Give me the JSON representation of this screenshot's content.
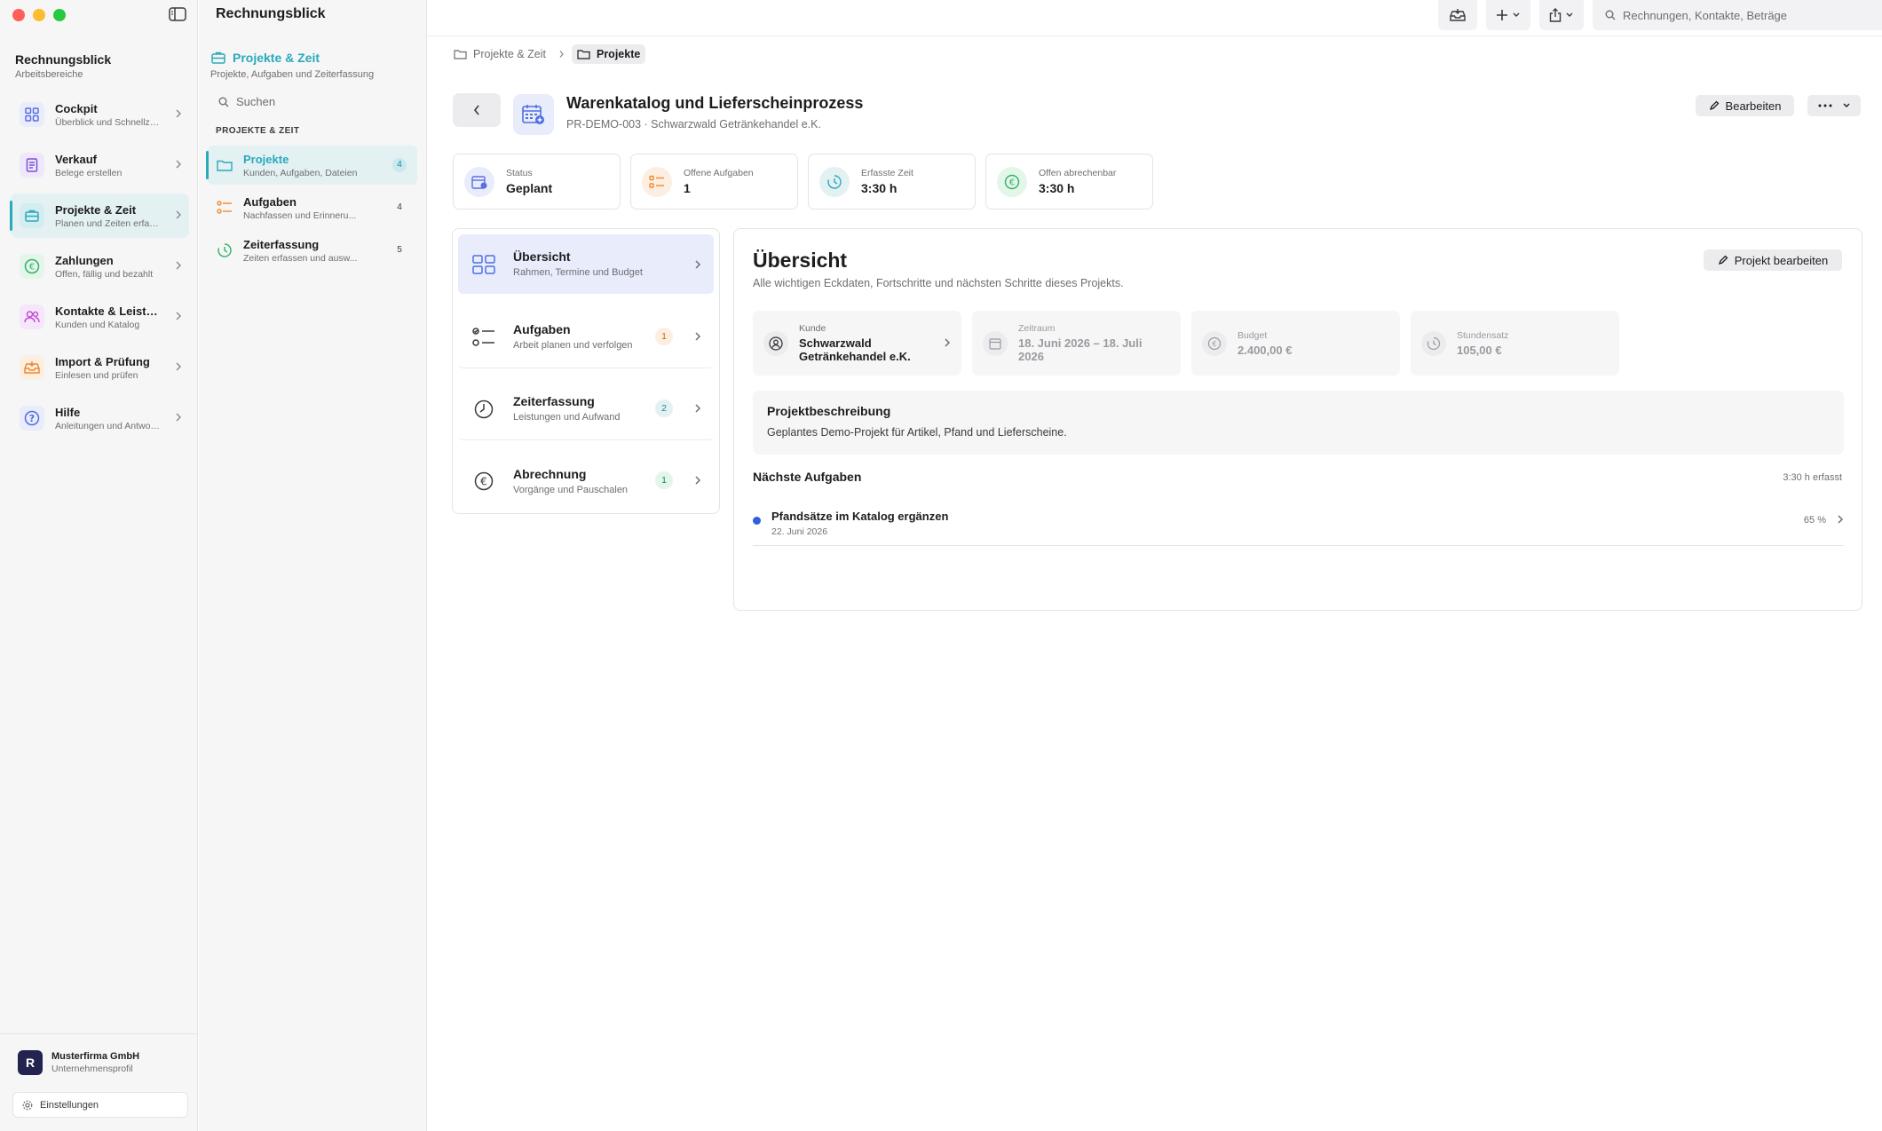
{
  "app": {
    "title": "Rechnungsblick"
  },
  "workspace": {
    "title": "Rechnungsblick",
    "subtitle": "Arbeitsbereiche"
  },
  "sidebar": {
    "items": [
      {
        "label": "Cockpit",
        "sub": "Überblick und Schnellzu...",
        "color": "#5b6ee1"
      },
      {
        "label": "Verkauf",
        "sub": "Belege erstellen",
        "color": "#7b4fd6"
      },
      {
        "label": "Projekte & Zeit",
        "sub": "Planen und Zeiten erfass...",
        "color": "#2aa9bb"
      },
      {
        "label": "Zahlungen",
        "sub": "Offen, fällig und bezahlt",
        "color": "#2fb366"
      },
      {
        "label": "Kontakte & Leistung...",
        "sub": "Kunden und Katalog",
        "color": "#c24fd6"
      },
      {
        "label": "Import & Prüfung",
        "sub": "Einlesen und prüfen",
        "color": "#ef8a2c"
      },
      {
        "label": "Hilfe",
        "sub": "Anleitungen und Antwort...",
        "color": "#4f6ee1"
      }
    ],
    "company": {
      "logo": "R",
      "name": "Musterfirma GmbH",
      "sub": "Unternehmensprofil"
    },
    "settings_label": "Einstellungen"
  },
  "subnav": {
    "title": "Projekte & Zeit",
    "description": "Projekte, Aufgaben und Zeiterfassung",
    "search_placeholder": "Suchen",
    "section": "PROJEKTE & ZEIT",
    "items": [
      {
        "label": "Projekte",
        "sub": "Kunden, Aufgaben, Dateien",
        "count": "4"
      },
      {
        "label": "Aufgaben",
        "sub": "Nachfassen und Erinneru...",
        "count": "4"
      },
      {
        "label": "Zeiterfassung",
        "sub": "Zeiten erfassen und ausw...",
        "count": "5"
      }
    ]
  },
  "toolbar": {
    "search_placeholder": "Rechnungen, Kontakte, Beträge"
  },
  "breadcrumb": {
    "parent": "Projekte & Zeit",
    "current": "Projekte"
  },
  "project": {
    "title": "Warenkatalog und Lieferscheinprozess",
    "subtitle": "PR-DEMO-003 · Schwarzwald Getränkehandel e.K.",
    "edit_label": "Bearbeiten"
  },
  "stats": [
    {
      "label": "Status",
      "value": "Geplant",
      "color": "#5b6ee1"
    },
    {
      "label": "Offene Aufgaben",
      "value": "1",
      "color": "#ef8a2c"
    },
    {
      "label": "Erfasste Zeit",
      "value": "3:30 h",
      "color": "#2aa9bb"
    },
    {
      "label": "Offen abrechenbar",
      "value": "3:30 h",
      "color": "#2fb366"
    }
  ],
  "sections": [
    {
      "label": "Übersicht",
      "sub": "Rahmen, Termine und Budget",
      "count": ""
    },
    {
      "label": "Aufgaben",
      "sub": "Arbeit planen und verfolgen",
      "count": "1"
    },
    {
      "label": "Zeiterfassung",
      "sub": "Leistungen und Aufwand",
      "count": "2"
    },
    {
      "label": "Abrechnung",
      "sub": "Vorgänge und Pauschalen",
      "count": "1"
    }
  ],
  "overview": {
    "title": "Übersicht",
    "description": "Alle wichtigen Eckdaten, Fortschritte und nächsten Schritte dieses Projekts.",
    "edit_label": "Projekt bearbeiten",
    "facts": [
      {
        "label": "Kunde",
        "value": "Schwarzwald Getränkehandel e.K."
      },
      {
        "label": "Zeitraum",
        "value": "18. Juni 2026 – 18. Juli 2026"
      },
      {
        "label": "Budget",
        "value": "2.400,00 €"
      },
      {
        "label": "Stundensatz",
        "value": "105,00 €"
      }
    ],
    "desc_title": "Projektbeschreibung",
    "desc_text": "Geplantes Demo-Projekt für Artikel, Pfand und Lieferscheine.",
    "next_title": "Nächste Aufgaben",
    "logged": "3:30 h erfasst",
    "tasks": [
      {
        "title": "Pfandsätze im Katalog ergänzen",
        "date": "22. Juni 2026",
        "progress": "65 %"
      }
    ]
  }
}
